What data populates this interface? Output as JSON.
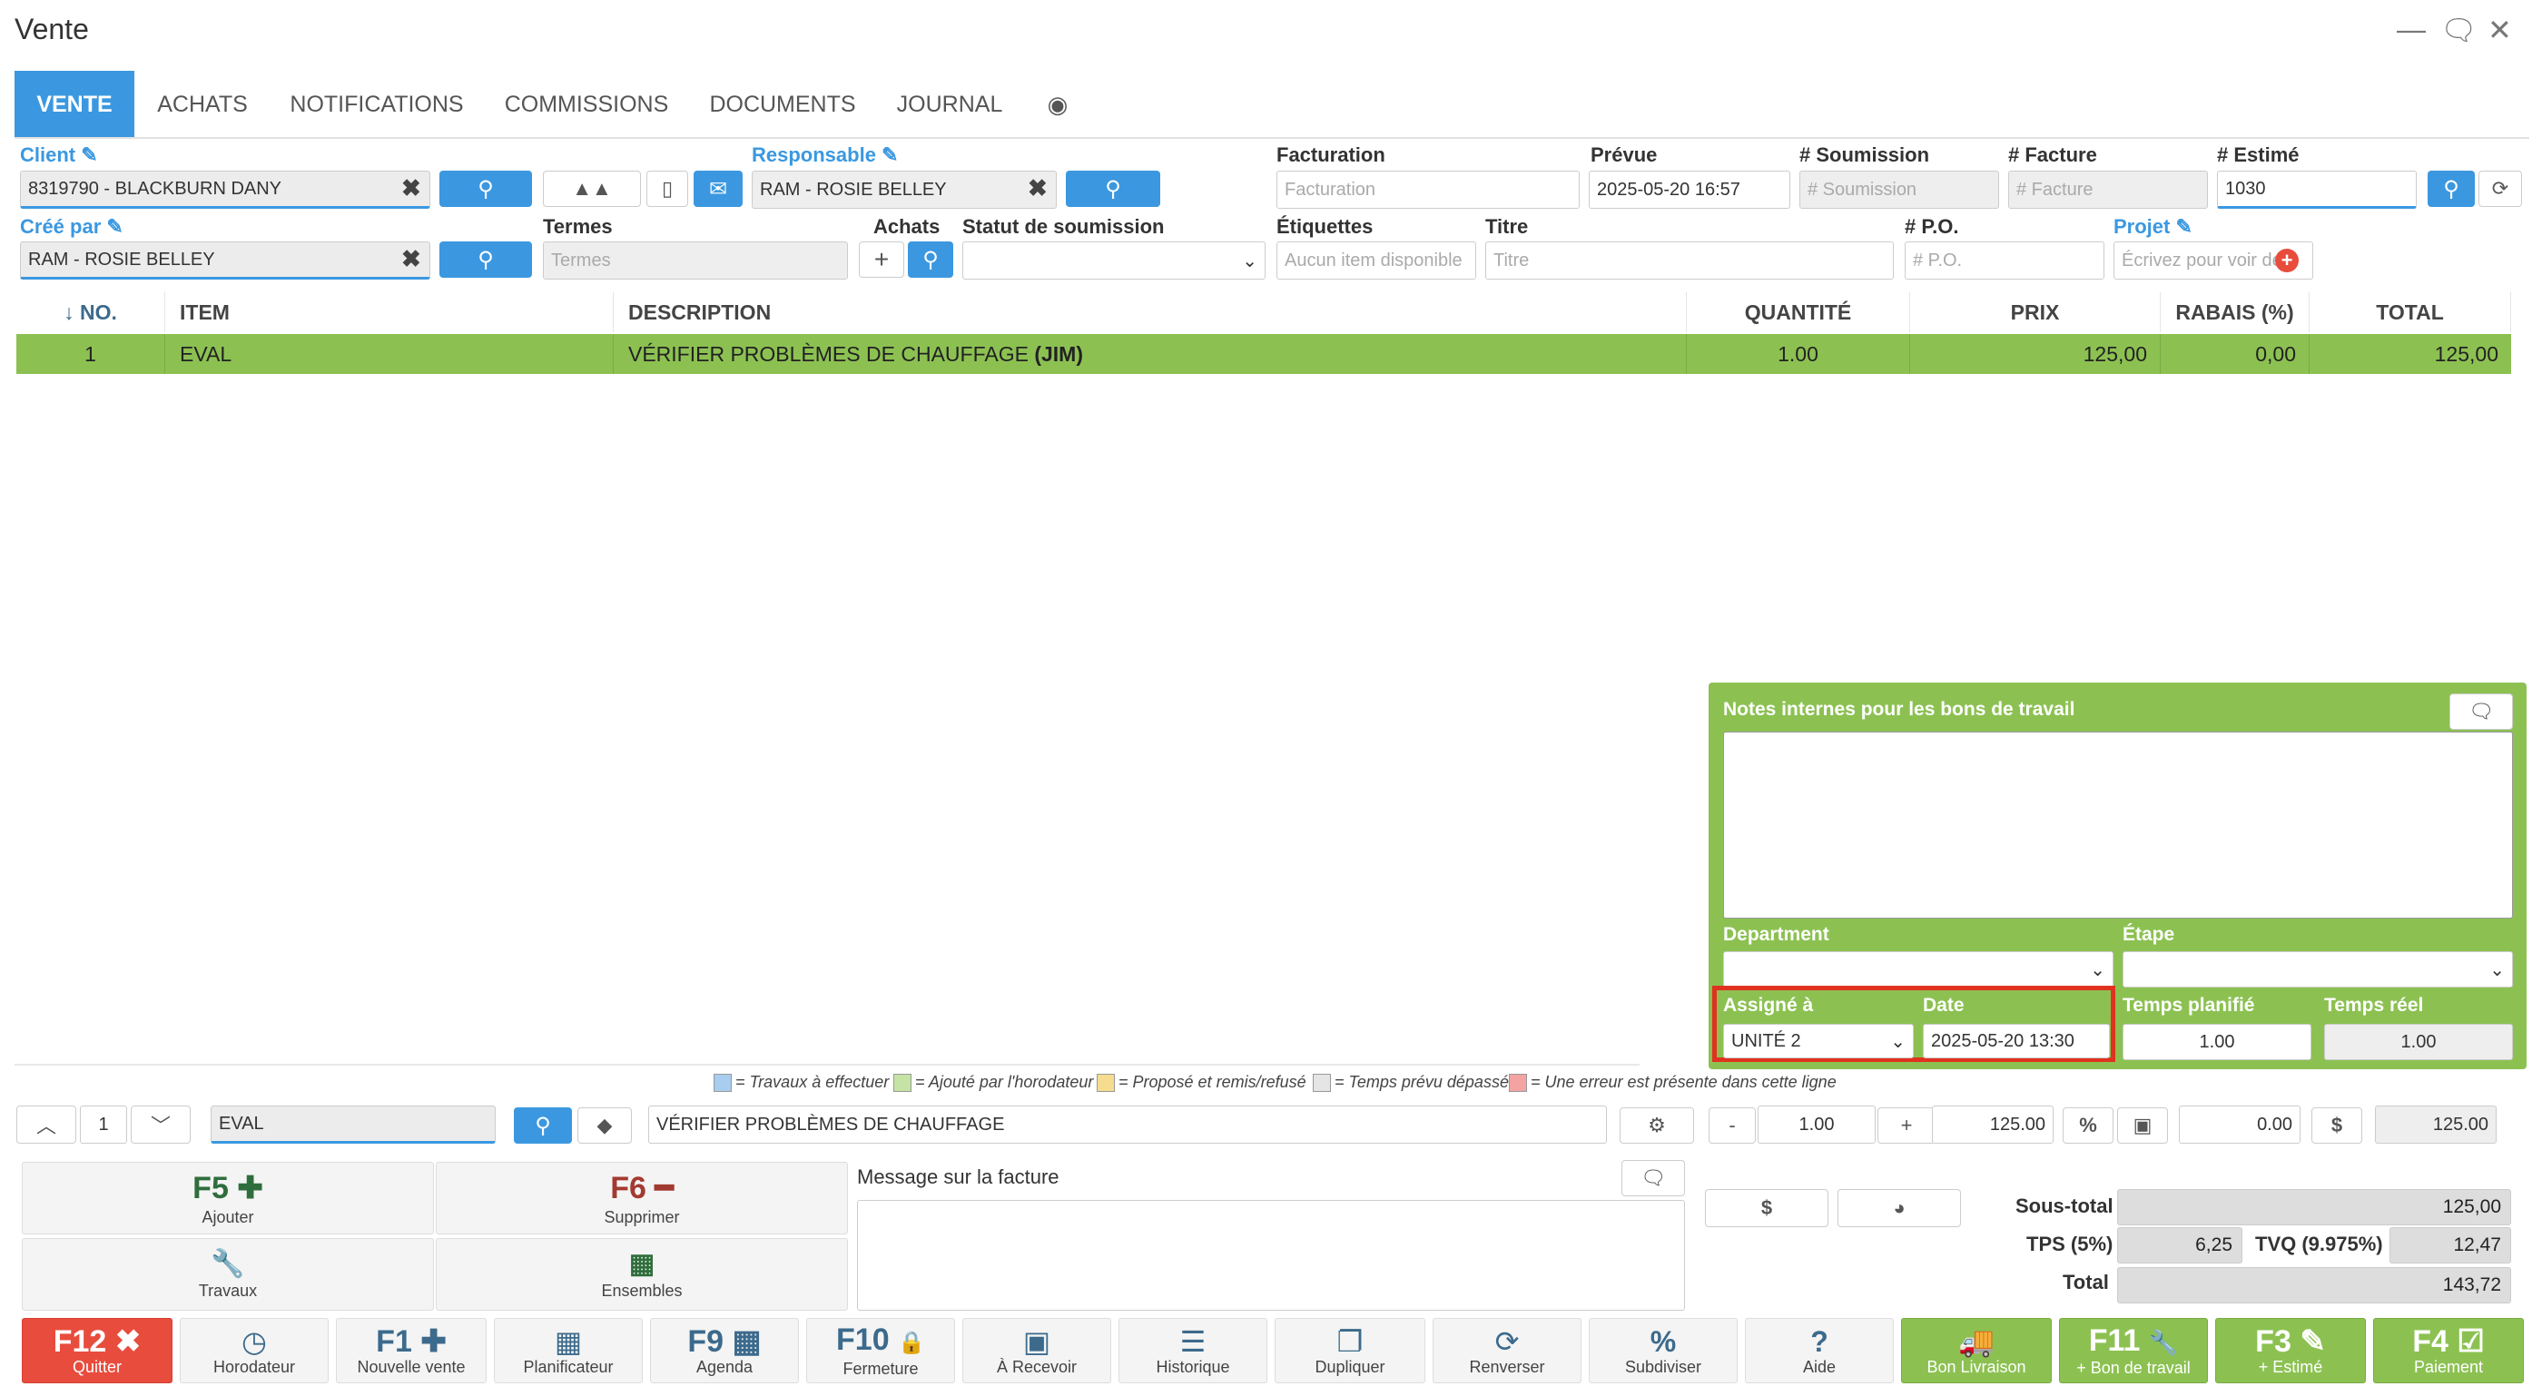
{
  "window": {
    "title": "Vente",
    "minimize": "—",
    "chat": "🗨",
    "close": "✕"
  },
  "tabs": [
    "VENTE",
    "ACHATS",
    "NOTIFICATIONS",
    "COMMISSIONS",
    "DOCUMENTS",
    "JOURNAL"
  ],
  "form": {
    "client_label": "Client",
    "client_value": "8319790 - BLACKBURN DANY",
    "responsable_label": "Responsable",
    "responsable_value": "RAM - ROSIE BELLEY",
    "facturation_label": "Facturation",
    "facturation_ph": "Facturation",
    "prevue_label": "Prévue",
    "prevue_value": "2025-05-20 16:57",
    "soumission_label": "# Soumission",
    "soumission_ph": "# Soumission",
    "facture_label": "# Facture",
    "facture_ph": "# Facture",
    "estime_label": "# Estimé",
    "estime_value": "1030",
    "cree_label": "Créé par",
    "cree_value": "RAM - ROSIE BELLEY",
    "termes_label": "Termes",
    "termes_ph": "Termes",
    "achats_label": "Achats",
    "statut_label": "Statut de soumission",
    "etiquettes_label": "Étiquettes",
    "etiquettes_ph": "Aucun item disponible",
    "titre_label": "Titre",
    "titre_ph": "Titre",
    "po_label": "# P.O.",
    "po_ph": "# P.O.",
    "projet_label": "Projet",
    "projet_ph": "Écrivez pour voir des"
  },
  "table": {
    "headers": [
      "↓ NO.",
      "ITEM",
      "DESCRIPTION",
      "QUANTITÉ",
      "PRIX",
      "RABAIS (%)",
      "TOTAL"
    ],
    "rows": [
      {
        "no": "1",
        "item": "EVAL",
        "desc": "VÉRIFIER PROBLÈMES DE CHAUFFAGE ",
        "desc_bold": "(JIM)",
        "qty": "1.00",
        "prix": "125,00",
        "rabais": "0,00",
        "total": "125,00"
      }
    ]
  },
  "panel": {
    "notes_label": "Notes internes pour les bons de travail",
    "department_label": "Department",
    "etape_label": "Étape",
    "assigne_label": "Assigné à",
    "assigne_value": "UNITÉ 2",
    "date_label": "Date",
    "date_value": "2025-05-20 13:30",
    "temps_planifie_label": "Temps planifié",
    "temps_planifie_value": "1.00",
    "temps_reel_label": "Temps réel",
    "temps_reel_value": "1.00"
  },
  "legend": [
    {
      "color": "#a8cdee",
      "text": "= Travaux à effectuer"
    },
    {
      "color": "#c6e3a6",
      "text": "= Ajouté par l'horodateur"
    },
    {
      "color": "#f6dc8e",
      "text": "= Proposé et remis/refusé"
    },
    {
      "color": "#e5e5e5",
      "text": "= Temps prévu dépassé"
    },
    {
      "color": "#f4a3a3",
      "text": "= Une erreur est présente dans cette ligne"
    }
  ],
  "editor": {
    "line_no": "1",
    "item": "EVAL",
    "desc": "VÉRIFIER PROBLÈMES DE CHAUFFAGE",
    "minus": "-",
    "qty": "1.00",
    "plus": "+",
    "prix": "125.00",
    "pct": "%",
    "rabais": "0.00",
    "dollar": "$",
    "total": "125.00"
  },
  "actions": {
    "f5_key": "F5",
    "f5_label": "Ajouter",
    "f6_key": "F6",
    "f6_label": "Supprimer",
    "travaux_label": "Travaux",
    "ensembles_label": "Ensembles"
  },
  "message": {
    "label": "Message sur la facture"
  },
  "totals": {
    "dollar": "$",
    "sous_total_label": "Sous-total",
    "sous_total": "125,00",
    "tps_label": "TPS (5%)",
    "tps": "6,25",
    "tvq_label": "TVQ (9.975%)",
    "tvq": "12,47",
    "total_label": "Total",
    "total": "143,72"
  },
  "bottom": [
    {
      "key": "F12",
      "icon": "✖",
      "label": "Quitter"
    },
    {
      "key": "",
      "icon": "◷",
      "label": "Horodateur"
    },
    {
      "key": "F1",
      "icon": "✚",
      "label": "Nouvelle vente"
    },
    {
      "key": "",
      "icon": "▦",
      "label": "Planificateur"
    },
    {
      "key": "F9",
      "icon": "▦",
      "label": "Agenda"
    },
    {
      "key": "F10",
      "icon": "🔒",
      "label": "Fermeture"
    },
    {
      "key": "",
      "icon": "▣",
      "label": "À Recevoir"
    },
    {
      "key": "",
      "icon": "☰",
      "label": "Historique"
    },
    {
      "key": "",
      "icon": "❐",
      "label": "Dupliquer"
    },
    {
      "key": "",
      "icon": "⟳",
      "label": "Renverser"
    },
    {
      "key": "",
      "icon": "%",
      "label": "Subdiviser"
    },
    {
      "key": "",
      "icon": "?",
      "label": "Aide"
    },
    {
      "key": "",
      "icon": "🚚",
      "label": "Bon Livraison"
    },
    {
      "key": "F11",
      "icon": "🔧",
      "label": "+ Bon de travail"
    },
    {
      "key": "F3",
      "icon": "✎",
      "label": "+ Estimé"
    },
    {
      "key": "F4",
      "icon": "☑",
      "label": "Paiement"
    }
  ],
  "colors": {
    "accent": "#3b98e0",
    "green": "#8cc152",
    "red": "#e84c3d",
    "highlight": "#e0321f"
  }
}
